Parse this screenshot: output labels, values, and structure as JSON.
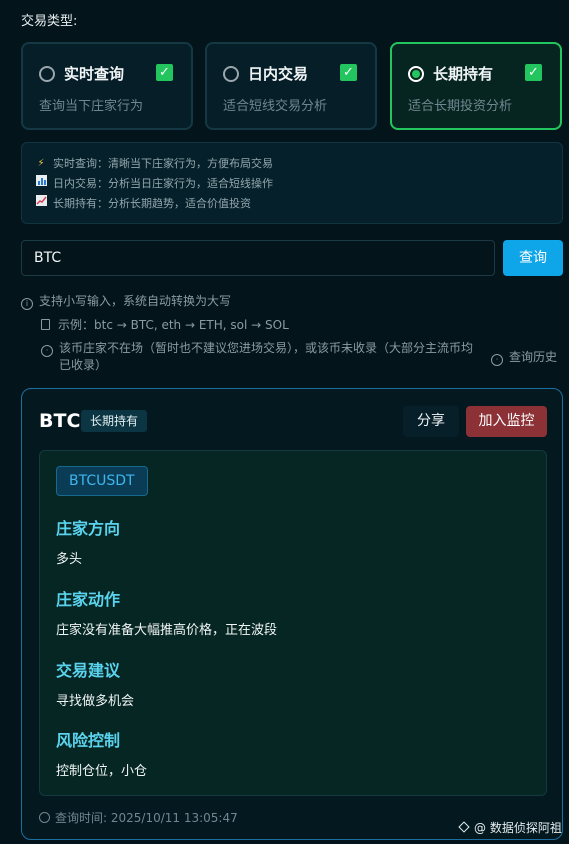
{
  "trade_type": {
    "label": "交易类型:",
    "options": [
      {
        "title": "实时查询",
        "desc": "查询当下庄家行为",
        "selected": false,
        "checked": true
      },
      {
        "title": "日内交易",
        "desc": "适合短线交易分析",
        "selected": false,
        "checked": true
      },
      {
        "title": "长期持有",
        "desc": "适合长期投资分析",
        "selected": true,
        "checked": true
      }
    ]
  },
  "info": {
    "lines": [
      {
        "icon": "lightning-icon",
        "text": "实时查询：清晰当下庄家行为，方便布局交易"
      },
      {
        "icon": "bar-chart-icon",
        "text": "日内交易：分析当日庄家行为，适合短线操作"
      },
      {
        "icon": "trend-chart-icon",
        "text": "长期持有：分析长期趋势，适合价值投资"
      }
    ]
  },
  "search": {
    "value": "BTC",
    "button": "查询"
  },
  "hints": {
    "uppercase": "支持小写输入，系统自动转换为大写",
    "example": "示例：btc → BTC, eth → ETH, sol → SOL",
    "warning_line1": "该币庄家不在场（暂时也不建议您进场交易），或该币未收录（大部分主流币均",
    "warning_line2": "已收录）",
    "history": "查询历史"
  },
  "result": {
    "coin": "BTC",
    "mode": "长期持有",
    "share": "分享",
    "monitor": "加入监控",
    "pair": "BTCUSDT",
    "sections": [
      {
        "heading": "庄家方向",
        "value": "多头"
      },
      {
        "heading": "庄家动作",
        "value": "庄家没有准备大幅推高价格，正在波段"
      },
      {
        "heading": "交易建议",
        "value": "寻找做多机会"
      },
      {
        "heading": "风险控制",
        "value": "控制仓位，小仓"
      }
    ],
    "query_time": "查询时间: 2025/10/11 13:05:47"
  },
  "watermark": "@ 数据侦探阿祖",
  "colors": {
    "accent_green": "#22c55e",
    "accent_blue": "#0ea5e9",
    "danger": "#8c3236",
    "heading_cyan": "#5ad3ee"
  }
}
